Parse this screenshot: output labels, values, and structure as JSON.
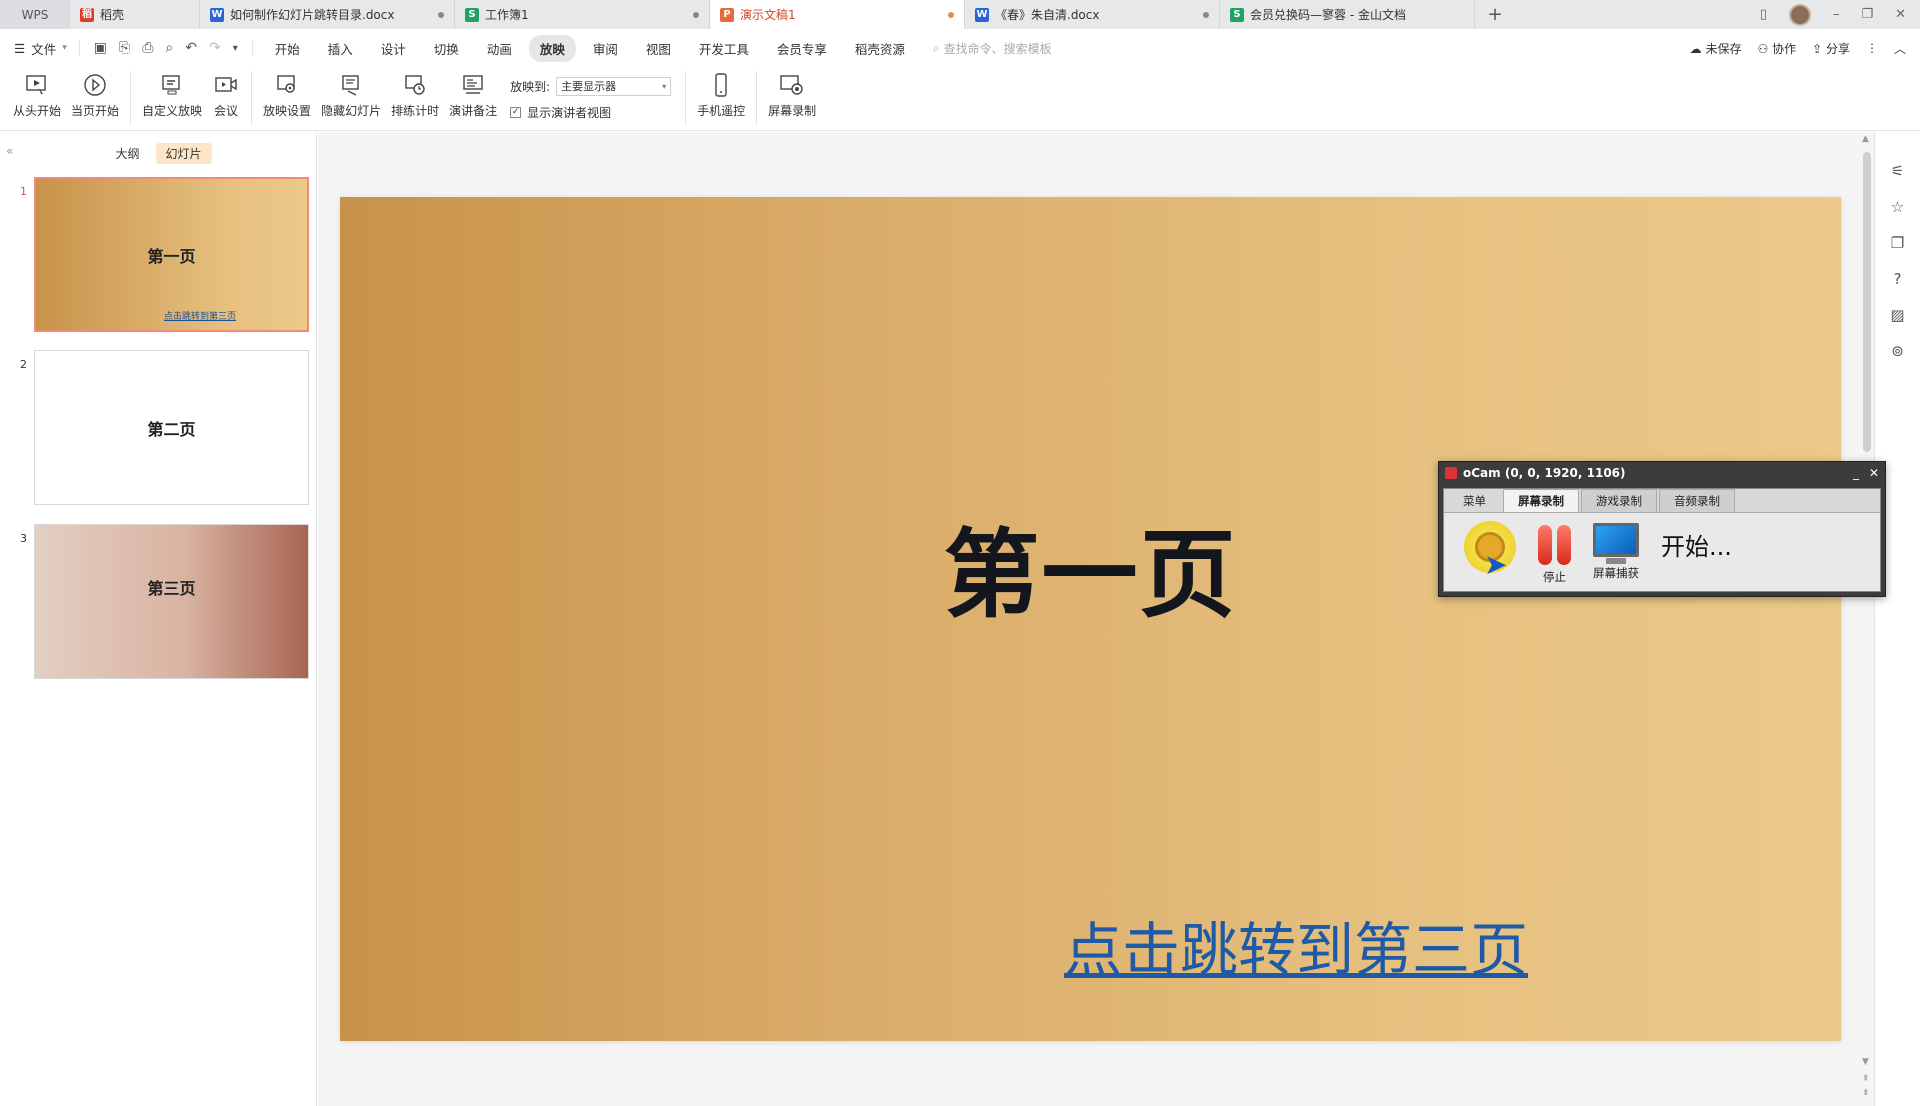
{
  "titlebar": {
    "wps_label": "WPS",
    "tabs": [
      {
        "label": "稻壳",
        "icon": "docer-icon",
        "color": "#e23b2e"
      },
      {
        "label": "如何制作幻灯片跳转目录.docx",
        "icon": "word-icon",
        "color": "#2b63d8"
      },
      {
        "label": "工作簿1",
        "icon": "sheet-icon",
        "color": "#1ea362"
      },
      {
        "label": "演示文稿1",
        "icon": "ppt-icon",
        "color": "#e8683f"
      },
      {
        "label": "《春》朱自清.docx",
        "icon": "word-icon",
        "color": "#2b63d8"
      },
      {
        "label": "会员兑换码—寥蓉 - 金山文档",
        "icon": "sheet-icon",
        "color": "#1ea362"
      }
    ],
    "add_tab": "+"
  },
  "menubar": {
    "file": "文件",
    "items": [
      "开始",
      "插入",
      "设计",
      "切换",
      "动画",
      "放映",
      "审阅",
      "视图",
      "开发工具",
      "会员专享",
      "稻壳资源"
    ],
    "active": "放映",
    "search_placeholder": "查找命令、搜索模板",
    "unsaved": "未保存",
    "collab": "协作",
    "share": "分享"
  },
  "ribbon": {
    "from_start": "从头开始",
    "from_current": "当页开始",
    "custom_show": "自定义放映",
    "meeting": "会议",
    "show_settings": "放映设置",
    "hide_slide": "隐藏幻灯片",
    "rehearse": "排练计时",
    "speaker_notes": "演讲备注",
    "show_to_label": "放映到:",
    "show_to_value": "主要显示器",
    "presenter_view": "显示演讲者视图",
    "phone_remote": "手机遥控",
    "screen_record": "屏幕录制"
  },
  "leftpanel": {
    "tab_outline": "大纲",
    "tab_slides": "幻灯片",
    "slides": [
      {
        "num": "1",
        "title": "第一页",
        "link": "点击跳转到第三页"
      },
      {
        "num": "2",
        "title": "第二页"
      },
      {
        "num": "3",
        "title": "第三页"
      }
    ]
  },
  "slide": {
    "title": "第一页",
    "link": "点击跳转到第三页"
  },
  "ocam": {
    "title": "oCam (0, 0, 1920, 1106)",
    "tabs": [
      "菜单",
      "屏幕录制",
      "游戏录制",
      "音频录制"
    ],
    "active_tab": "屏幕录制",
    "stop": "停止",
    "capture": "屏幕捕获",
    "start": "开始..."
  },
  "colors": {
    "accent": "#d24726",
    "link": "#1f5aa6",
    "selected_border": "#f28b76"
  }
}
